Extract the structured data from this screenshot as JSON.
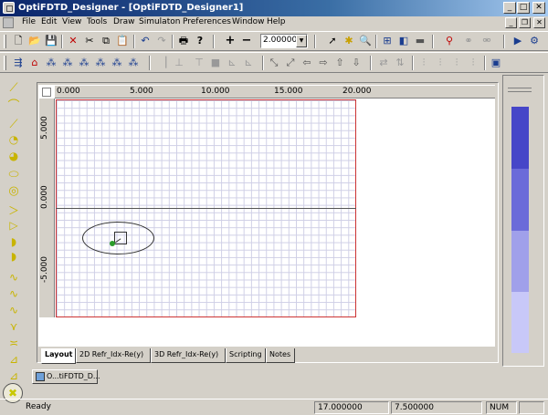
{
  "window": {
    "title": "OptiFDTD_Designer - [OptiFDTD_Designer1]"
  },
  "caption_buttons": {
    "minimize": "_",
    "maximize": "□",
    "close": "✕"
  },
  "mdi_buttons": {
    "minimize": "_",
    "restore": "❐",
    "close": "✕"
  },
  "menu": {
    "items": [
      "File",
      "Edit",
      "View",
      "Tools",
      "Draw",
      "Simulaton",
      "Preferences",
      "Window",
      "Help"
    ]
  },
  "toolbar": {
    "zoom_value": "2.00000",
    "zoom_drop": "▼"
  },
  "ruler": {
    "x_labels": [
      "0.000",
      "5.000",
      "10.000",
      "15.000",
      "20.000"
    ],
    "y_labels": [
      "5.000",
      "0.000",
      "-5.000"
    ]
  },
  "tabs": [
    "Layout",
    "2D Refr_Idx-Re(y)",
    "3D Refr_Idx-Re(y)",
    "Scripting",
    "Notes"
  ],
  "window_tab": {
    "label": "O...tiFDTD_D..."
  },
  "status": {
    "text": "Ready",
    "x_value": "17.000000",
    "y_value": "7.500000",
    "num": "NUM"
  },
  "colors": {
    "title_start": "#0a246a",
    "grid_border": "#cc3333",
    "color_bar": [
      "#4646c8",
      "#6b6bd9",
      "#a0a0ea",
      "#c8c8f8"
    ]
  }
}
